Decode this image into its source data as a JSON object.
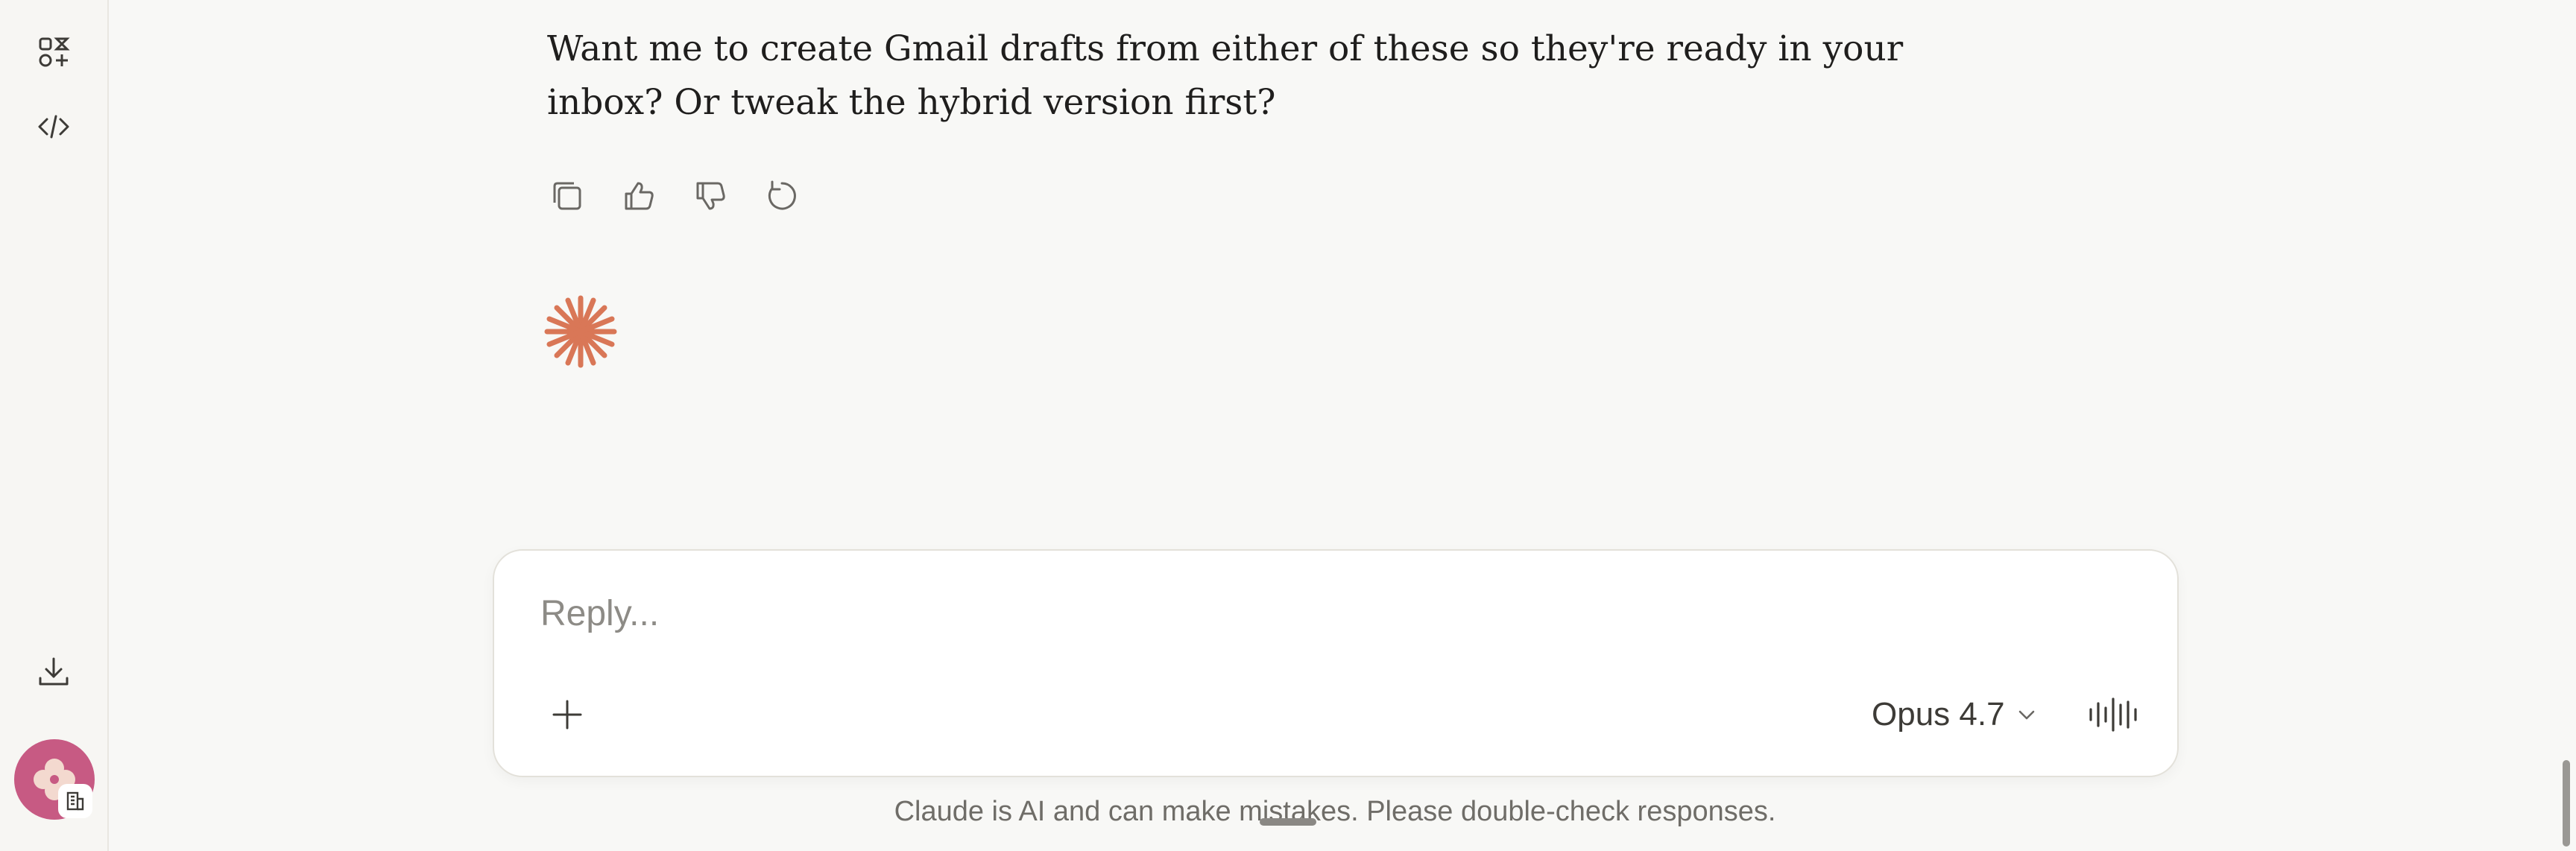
{
  "sidebar": {
    "top_items": [
      {
        "icon": "apps-icon",
        "label": ""
      },
      {
        "icon": "code-icon",
        "label": ""
      }
    ],
    "bottom_items": [
      {
        "icon": "download-icon"
      }
    ],
    "avatar": {
      "color": "#c75a83",
      "badge_icon": "building-icon"
    }
  },
  "message": {
    "text": "Want me to create Gmail drafts from either of these so they're ready in your inbox? Or tweak the hybrid version first?",
    "actions": [
      "copy-icon",
      "thumbs-up-icon",
      "thumbs-down-icon",
      "retry-icon"
    ]
  },
  "spinner": {
    "icon": "claude-spark-icon",
    "color": "#d97757"
  },
  "composer": {
    "placeholder": "Reply...",
    "value": "",
    "model_label": "Opus 4.7"
  },
  "footer": {
    "disclaimer": "Claude is AI and can make mistakes. Please double-check responses."
  },
  "colors": {
    "background": "#f8f8f6",
    "accent": "#d97757",
    "text": "#1f1e1d"
  }
}
